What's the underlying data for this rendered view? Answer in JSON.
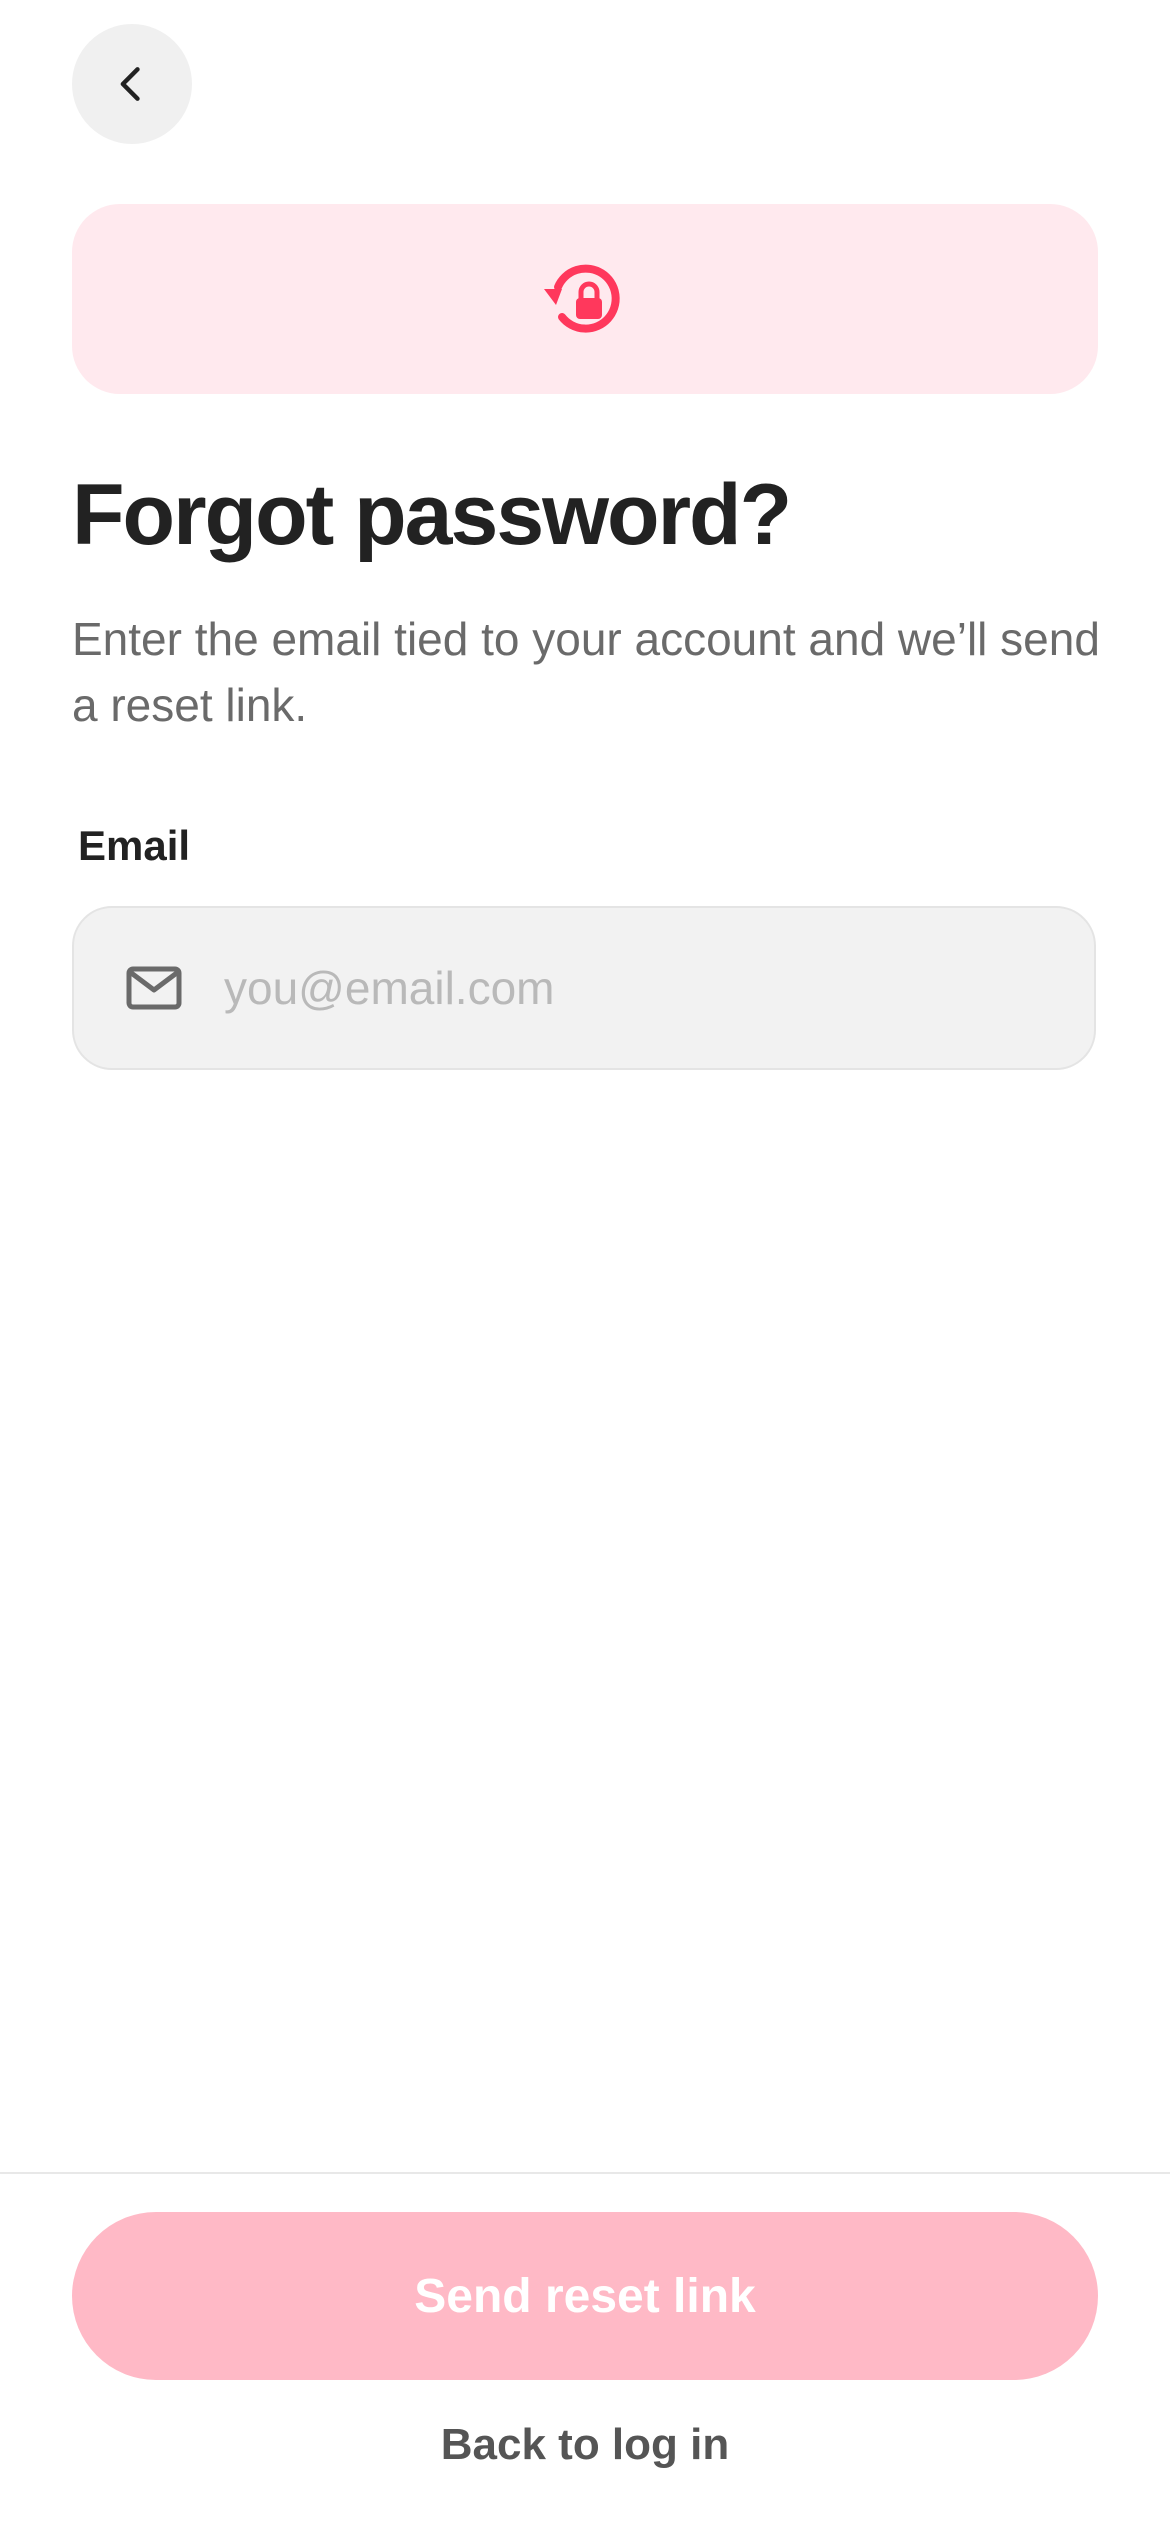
{
  "header": {
    "back_icon": "chevron-left-icon"
  },
  "hero": {
    "icon": "lock-reset-icon",
    "accent_color": "#ff385c",
    "background_color": "#ffe9ee"
  },
  "content": {
    "title": "Forgot password?",
    "subtitle": "Enter the email tied to your account and we’ll send a reset link."
  },
  "form": {
    "email_label": "Email",
    "email_icon": "mail-icon",
    "email_value": "",
    "email_placeholder": "you@email.com"
  },
  "footer": {
    "send_button_label": "Send reset link",
    "send_button_color": "#ffb9c6",
    "back_to_login_label": "Back to log in"
  }
}
